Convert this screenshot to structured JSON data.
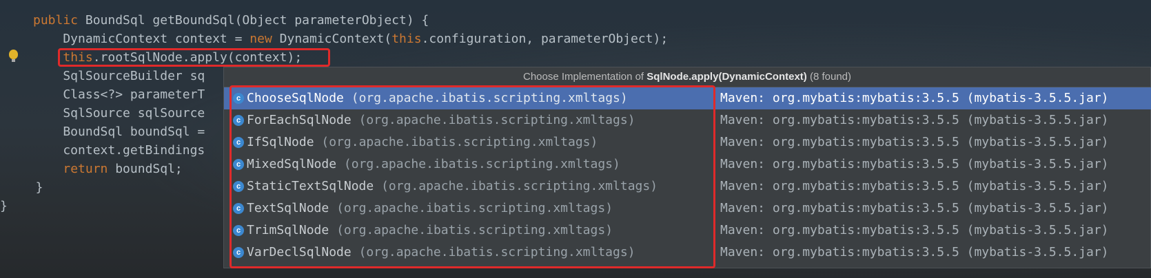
{
  "code_lines": [
    [
      "public ",
      "BoundSql getBoundSql(Object parameterObject) {"
    ],
    [
      "",
      "    DynamicContext context = ",
      "new ",
      "DynamicContext(",
      "this",
      ".configuration, parameterObject);"
    ],
    [
      "",
      "    ",
      "this",
      ".rootSqlNode.apply(context);"
    ],
    [
      "",
      "    SqlSourceBuilder sq"
    ],
    [
      "",
      "    Class<?> parameterT"
    ],
    [
      "",
      "    SqlSource sqlSource"
    ],
    [
      "",
      "    BoundSql boundSql ="
    ],
    [
      "",
      "    context.getBindings"
    ],
    [
      "",
      "    ",
      "return ",
      "boundSql;"
    ],
    [
      "",
      "  }"
    ],
    [
      "",
      "}"
    ]
  ],
  "popup": {
    "title_prefix": "Choose Implementation of ",
    "title_method": "SqlNode.apply(DynamicContext)",
    "title_suffix": " (8 found)"
  },
  "implementations": [
    {
      "name": "ChooseSqlNode",
      "package": "(org.apache.ibatis.scripting.xmltags)",
      "location": "Maven: org.mybatis:mybatis:3.5.5 (mybatis-3.5.5.jar)",
      "selected": true
    },
    {
      "name": "ForEachSqlNode",
      "package": "(org.apache.ibatis.scripting.xmltags)",
      "location": "Maven: org.mybatis:mybatis:3.5.5 (mybatis-3.5.5.jar)",
      "selected": false
    },
    {
      "name": "IfSqlNode",
      "package": "(org.apache.ibatis.scripting.xmltags)",
      "location": "Maven: org.mybatis:mybatis:3.5.5 (mybatis-3.5.5.jar)",
      "selected": false
    },
    {
      "name": "MixedSqlNode",
      "package": "(org.apache.ibatis.scripting.xmltags)",
      "location": "Maven: org.mybatis:mybatis:3.5.5 (mybatis-3.5.5.jar)",
      "selected": false
    },
    {
      "name": "StaticTextSqlNode",
      "package": "(org.apache.ibatis.scripting.xmltags)",
      "location": "Maven: org.mybatis:mybatis:3.5.5 (mybatis-3.5.5.jar)",
      "selected": false
    },
    {
      "name": "TextSqlNode",
      "package": "(org.apache.ibatis.scripting.xmltags)",
      "location": "Maven: org.mybatis:mybatis:3.5.5 (mybatis-3.5.5.jar)",
      "selected": false
    },
    {
      "name": "TrimSqlNode",
      "package": "(org.apache.ibatis.scripting.xmltags)",
      "location": "Maven: org.mybatis:mybatis:3.5.5 (mybatis-3.5.5.jar)",
      "selected": false
    },
    {
      "name": "VarDeclSqlNode",
      "package": "(org.apache.ibatis.scripting.xmltags)",
      "location": "Maven: org.mybatis:mybatis:3.5.5 (mybatis-3.5.5.jar)",
      "selected": false
    }
  ],
  "icon_letter": "c",
  "colors": {
    "keyword": "#cc7832",
    "selection": "#4b6eaf",
    "annotation_border": "#e02a2a"
  }
}
